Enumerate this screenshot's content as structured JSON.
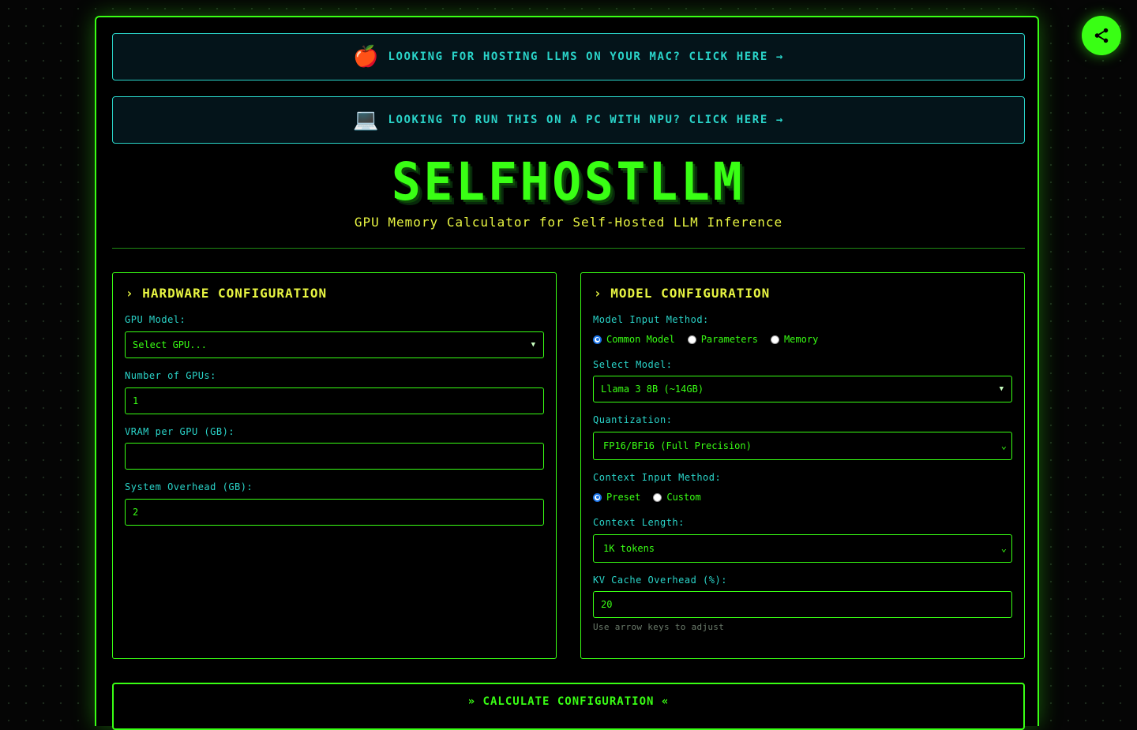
{
  "promos": [
    {
      "icon": "🍎",
      "text": "LOOKING FOR HOSTING LLMS ON YOUR MAC? CLICK HERE →"
    },
    {
      "icon": "💻",
      "text": "LOOKING TO RUN THIS ON A PC WITH NPU? CLICK HERE →"
    }
  ],
  "header": {
    "logo": "SELFHOSTLLM",
    "subtitle": "GPU Memory Calculator for Self-Hosted LLM Inference"
  },
  "hardware": {
    "title": "› HARDWARE CONFIGURATION",
    "gpu_model_label": "GPU Model:",
    "gpu_model_value": "Select GPU...",
    "num_gpus_label": "Number of GPUs:",
    "num_gpus_value": "1",
    "vram_label": "VRAM per GPU (GB):",
    "vram_value": "",
    "overhead_label": "System Overhead (GB):",
    "overhead_value": "2"
  },
  "model": {
    "title": "› MODEL CONFIGURATION",
    "input_method_label": "Model Input Method:",
    "input_methods": [
      "Common Model",
      "Parameters",
      "Memory"
    ],
    "input_method_selected": "Common Model",
    "select_model_label": "Select Model:",
    "select_model_value": "Llama 3 8B (~14GB)",
    "quantization_label": "Quantization:",
    "quantization_value": "FP16/BF16 (Full Precision)",
    "context_method_label": "Context Input Method:",
    "context_methods": [
      "Preset",
      "Custom"
    ],
    "context_method_selected": "Preset",
    "context_length_label": "Context Length:",
    "context_length_value": "1K tokens",
    "kv_cache_label": "KV Cache Overhead (%):",
    "kv_cache_value": "20",
    "kv_cache_hint": "Use arrow keys to adjust"
  },
  "actions": {
    "calculate_label": "» CALCULATE CONFIGURATION «"
  },
  "colors": {
    "primary": "#39ff14",
    "accent_cyan": "#2ad4c9",
    "accent_yellow": "#e8f542",
    "background": "#000000"
  },
  "icons": {
    "share": "share-icon"
  }
}
